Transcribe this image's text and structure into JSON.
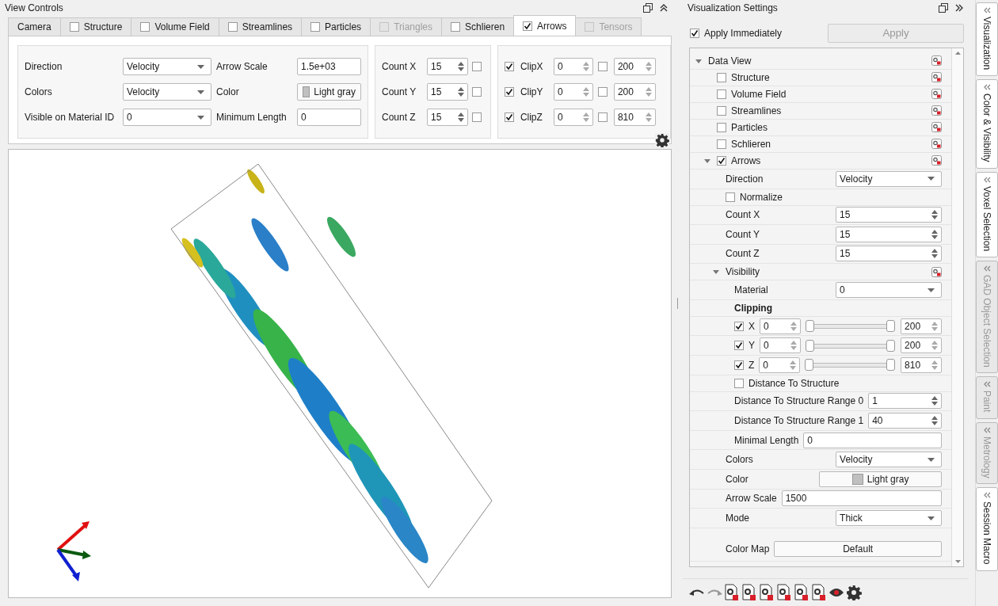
{
  "view_controls": {
    "title": "View Controls",
    "tabs": [
      {
        "label": "Camera",
        "kind": "plain",
        "selected": false,
        "disabled": false
      },
      {
        "label": "Structure",
        "kind": "check",
        "checked": false,
        "selected": false,
        "disabled": false
      },
      {
        "label": "Volume Field",
        "kind": "check",
        "checked": false,
        "selected": false,
        "disabled": false
      },
      {
        "label": "Streamlines",
        "kind": "check",
        "checked": false,
        "selected": false,
        "disabled": false
      },
      {
        "label": "Particles",
        "kind": "check",
        "checked": false,
        "selected": false,
        "disabled": false
      },
      {
        "label": "Triangles",
        "kind": "check",
        "checked": false,
        "selected": false,
        "disabled": true
      },
      {
        "label": "Schlieren",
        "kind": "check",
        "checked": false,
        "selected": false,
        "disabled": false
      },
      {
        "label": "Arrows",
        "kind": "check",
        "checked": true,
        "selected": true,
        "disabled": false
      },
      {
        "label": "Tensors",
        "kind": "check",
        "checked": false,
        "selected": false,
        "disabled": true
      }
    ],
    "fields": [
      {
        "label": "Direction",
        "kind": "dropdown",
        "value": "Velocity"
      },
      {
        "label": "Arrow Scale",
        "kind": "text",
        "value": "1.5e+03"
      },
      {
        "label": "Colors",
        "kind": "dropdown",
        "value": "Velocity"
      },
      {
        "label": "Color",
        "kind": "color",
        "value": "Light gray"
      },
      {
        "label": "Visible on Material ID",
        "kind": "dropdown",
        "value": "0"
      },
      {
        "label": "Minimum Length",
        "kind": "text",
        "value": "0"
      }
    ],
    "counts": [
      {
        "label": "Count X",
        "value": "15",
        "checked": false
      },
      {
        "label": "Count Y",
        "value": "15",
        "checked": false
      },
      {
        "label": "Count Z",
        "value": "15",
        "checked": false
      }
    ],
    "clips": [
      {
        "label": "ClipX",
        "checked": true,
        "min": "0",
        "max_checked": false,
        "max": "200"
      },
      {
        "label": "ClipY",
        "checked": true,
        "min": "0",
        "max_checked": false,
        "max": "200"
      },
      {
        "label": "ClipZ",
        "checked": true,
        "min": "0",
        "max_checked": false,
        "max": "810"
      }
    ]
  },
  "settings": {
    "title": "Visualization Settings",
    "apply_immediately": {
      "label": "Apply Immediately",
      "checked": true
    },
    "apply_button": {
      "label": "Apply",
      "disabled": true
    },
    "tree": [
      {
        "kind": "group",
        "label": "Data View",
        "expanded": true,
        "reset": true,
        "children": [
          {
            "kind": "check",
            "label": "Structure",
            "checked": false,
            "reset": true
          },
          {
            "kind": "check",
            "label": "Volume Field",
            "checked": false,
            "reset": true
          },
          {
            "kind": "check",
            "label": "Streamlines",
            "checked": false,
            "reset": true
          },
          {
            "kind": "check",
            "label": "Particles",
            "checked": false,
            "reset": true
          },
          {
            "kind": "check",
            "label": "Schlieren",
            "checked": false,
            "reset": true
          },
          {
            "kind": "check",
            "label": "Arrows",
            "checked": true,
            "reset": true,
            "expanded": true,
            "children": [
              {
                "kind": "dropdown",
                "label": "Direction",
                "value": "Velocity"
              },
              {
                "kind": "check",
                "label": "Normalize",
                "checked": false
              },
              {
                "kind": "spin",
                "label": "Count X",
                "value": "15"
              },
              {
                "kind": "spin",
                "label": "Count Y",
                "value": "15"
              },
              {
                "kind": "spin",
                "label": "Count Z",
                "value": "15"
              },
              {
                "kind": "group",
                "label": "Visibility",
                "expanded": true,
                "reset": true,
                "children": [
                  {
                    "kind": "dropdown",
                    "label": "Material",
                    "value": "0"
                  },
                  {
                    "kind": "heading",
                    "label": "Clipping"
                  },
                  {
                    "kind": "clip",
                    "label": "X",
                    "checked": true,
                    "min": "0",
                    "max": "200"
                  },
                  {
                    "kind": "clip",
                    "label": "Y",
                    "checked": true,
                    "min": "0",
                    "max": "200"
                  },
                  {
                    "kind": "clip",
                    "label": "Z",
                    "checked": true,
                    "min": "0",
                    "max": "810"
                  },
                  {
                    "kind": "check",
                    "label": "Distance To Structure",
                    "checked": false
                  },
                  {
                    "kind": "spin",
                    "label": "Distance To Structure Range 0",
                    "value": "1"
                  },
                  {
                    "kind": "spin",
                    "label": "Distance To Structure Range 1",
                    "value": "40"
                  },
                  {
                    "kind": "text",
                    "label": "Minimal Length",
                    "value": "0"
                  }
                ]
              },
              {
                "kind": "dropdown",
                "label": "Colors",
                "value": "Velocity"
              },
              {
                "kind": "color",
                "label": "Color",
                "value": "Light gray"
              },
              {
                "kind": "text",
                "label": "Arrow Scale",
                "value": "1500"
              },
              {
                "kind": "dropdown",
                "label": "Mode",
                "value": "Thick"
              },
              {
                "kind": "button",
                "label": "Color Map",
                "value": "Default"
              }
            ]
          }
        ]
      }
    ]
  },
  "side_tabs": [
    {
      "label": "Visualization",
      "disabled": false
    },
    {
      "label": "Color & Visibility",
      "disabled": false
    },
    {
      "label": "Voxel Selection",
      "disabled": false
    },
    {
      "label": "GAD Object Selection",
      "disabled": true
    },
    {
      "label": "Paint",
      "disabled": true
    },
    {
      "label": "Metrology",
      "disabled": true
    },
    {
      "label": "Session Macro",
      "disabled": false
    }
  ]
}
